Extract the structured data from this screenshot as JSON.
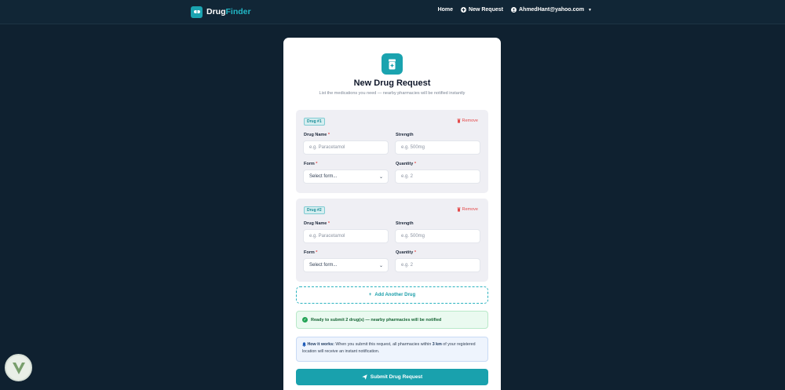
{
  "navbar": {
    "brand_part1": "Drug",
    "brand_part2": "Finder",
    "home": "Home",
    "new_request": "New Request",
    "user_email": "AhmedHant@yahoo.com"
  },
  "card": {
    "title": "New Drug Request",
    "subtitle": "List the medications you need — nearby pharmacies will be notified instantly"
  },
  "drugs": [
    {
      "badge": "Drug #1",
      "remove": "Remove",
      "name_label": "Drug Name",
      "name_placeholder": "e.g. Paracetamol",
      "strength_label": "Strength",
      "strength_placeholder": "e.g. 500mg",
      "form_label": "Form",
      "form_value": "Select form...",
      "quantity_label": "Quantity",
      "quantity_placeholder": "e.g. 2"
    },
    {
      "badge": "Drug #2",
      "remove": "Remove",
      "name_label": "Drug Name",
      "name_placeholder": "e.g. Paracetamol",
      "strength_label": "Strength",
      "strength_placeholder": "e.g. 500mg",
      "form_label": "Form",
      "form_value": "Select form...",
      "quantity_label": "Quantity",
      "quantity_placeholder": "e.g. 2"
    }
  ],
  "add_drug": "Add Another Drug",
  "ready_text": "Ready to submit 2 drug(s) — nearby pharmacies will be notified",
  "info": {
    "heading": "How it works:",
    "text_before": " When you submit this request, all pharmacies within ",
    "distance": "3 km",
    "text_after": " of your registered location will receive an instant notification."
  },
  "submit": "Submit Drug Request",
  "colors": {
    "accent": "#1aa3af",
    "background": "#0f2130",
    "danger": "#e44b4b",
    "success": "#22a355"
  },
  "icons": [
    "pill-logo-icon",
    "plus-circle-icon",
    "user-icon",
    "pill-bottle-icon",
    "trash-icon",
    "plus-icon",
    "check-circle-icon",
    "bell-icon",
    "send-icon"
  ]
}
